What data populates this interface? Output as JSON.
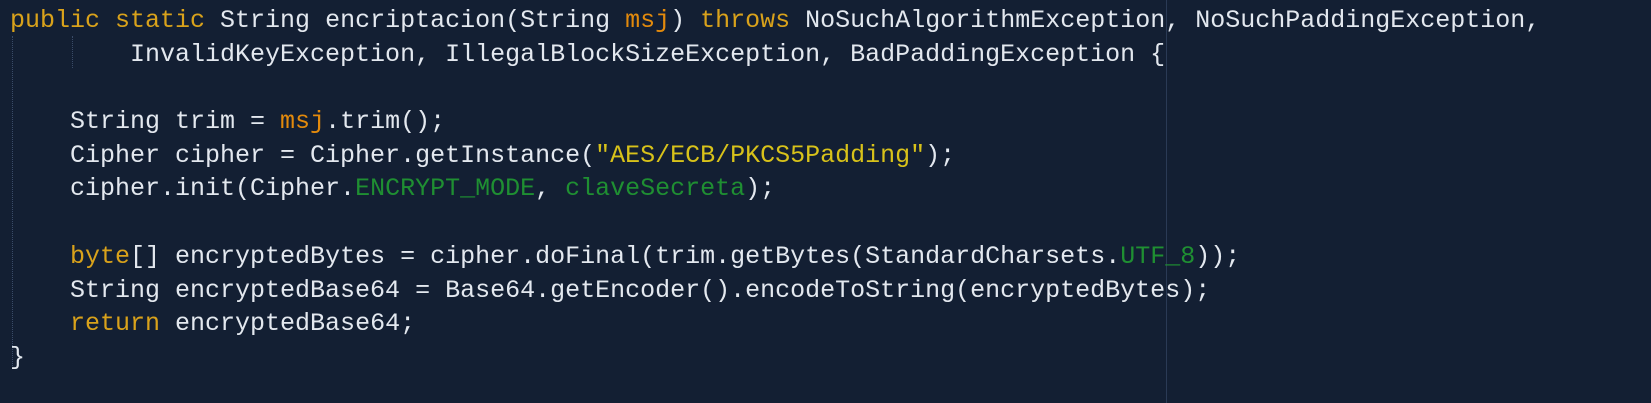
{
  "editor": {
    "lines": [
      [
        {
          "t": "kw",
          "v": "public"
        },
        {
          "t": "plain",
          "v": " "
        },
        {
          "t": "kw",
          "v": "static"
        },
        {
          "t": "plain",
          "v": " String encriptacion(String "
        },
        {
          "t": "param",
          "v": "msj"
        },
        {
          "t": "plain",
          "v": ") "
        },
        {
          "t": "kw",
          "v": "throws"
        },
        {
          "t": "plain",
          "v": " NoSuchAlgorithmException, NoSuchPaddingException,"
        }
      ],
      [
        {
          "t": "plain",
          "v": "        InvalidKeyException, IllegalBlockSizeException, BadPaddingException {"
        }
      ],
      [],
      [
        {
          "t": "plain",
          "v": "    String trim = "
        },
        {
          "t": "param",
          "v": "msj"
        },
        {
          "t": "plain",
          "v": ".trim();"
        }
      ],
      [
        {
          "t": "plain",
          "v": "    Cipher cipher = Cipher.getInstance("
        },
        {
          "t": "str",
          "v": "\"AES/ECB/PKCS5Padding\""
        },
        {
          "t": "plain",
          "v": ");"
        }
      ],
      [
        {
          "t": "plain",
          "v": "    cipher.init(Cipher."
        },
        {
          "t": "field",
          "v": "ENCRYPT_MODE"
        },
        {
          "t": "plain",
          "v": ", "
        },
        {
          "t": "field",
          "v": "claveSecreta"
        },
        {
          "t": "plain",
          "v": ");"
        }
      ],
      [],
      [
        {
          "t": "plain",
          "v": "    "
        },
        {
          "t": "kw",
          "v": "byte"
        },
        {
          "t": "plain",
          "v": "[] encryptedBytes = cipher.doFinal(trim.getBytes(StandardCharsets."
        },
        {
          "t": "field",
          "v": "UTF_8"
        },
        {
          "t": "plain",
          "v": "));"
        }
      ],
      [
        {
          "t": "plain",
          "v": "    String encryptedBase64 = Base64.getEncoder().encodeToString(encryptedBytes);"
        }
      ],
      [
        {
          "t": "plain",
          "v": "    "
        },
        {
          "t": "kw",
          "v": "return"
        },
        {
          "t": "plain",
          "v": " encryptedBase64;"
        }
      ],
      [
        {
          "t": "plain",
          "v": "}"
        }
      ]
    ]
  }
}
